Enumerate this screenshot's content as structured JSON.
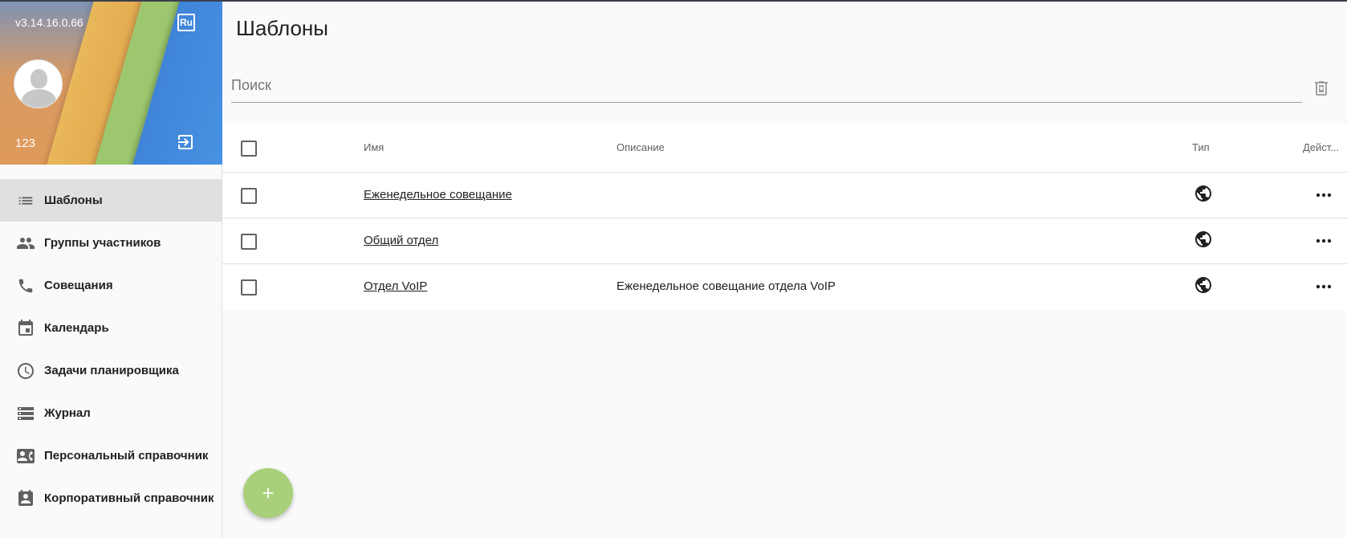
{
  "sidebar": {
    "version": "v3.14.16.0.66",
    "language": "Ru",
    "username": "123",
    "items": [
      {
        "label": "Шаблоны",
        "icon": "list-icon",
        "active": true
      },
      {
        "label": "Группы участников",
        "icon": "people-icon",
        "active": false
      },
      {
        "label": "Совещания",
        "icon": "phone-icon",
        "active": false
      },
      {
        "label": "Календарь",
        "icon": "calendar-icon",
        "active": false
      },
      {
        "label": "Задачи планировщика",
        "icon": "clock-icon",
        "active": false
      },
      {
        "label": "Журнал",
        "icon": "storage-icon",
        "active": false
      },
      {
        "label": "Персональный справочник",
        "icon": "contact-card-icon",
        "active": false
      },
      {
        "label": "Корпоративный справочник",
        "icon": "contact-book-icon",
        "active": false
      }
    ]
  },
  "main": {
    "title": "Шаблоны",
    "search": {
      "placeholder": "Поиск",
      "value": ""
    },
    "table": {
      "columns": {
        "name": "Имя",
        "description": "Описание",
        "type": "Тип",
        "actions": "Дейст..."
      },
      "rows": [
        {
          "name": "Еженедельное совещание",
          "description": "",
          "type_icon": "globe-icon"
        },
        {
          "name": "Общий отдел",
          "description": "",
          "type_icon": "globe-icon"
        },
        {
          "name": "Отдел VoIP",
          "description": "Еженедельное совещание отдела VoIP",
          "type_icon": "globe-icon"
        }
      ]
    },
    "fab_label": "+"
  },
  "colors": {
    "active_nav_bg": "#e0e0e0",
    "fab": "#a8d07a",
    "header_blue": "#4a96e4",
    "header_orange": "#e3a94f",
    "header_green": "#9cc76e"
  }
}
